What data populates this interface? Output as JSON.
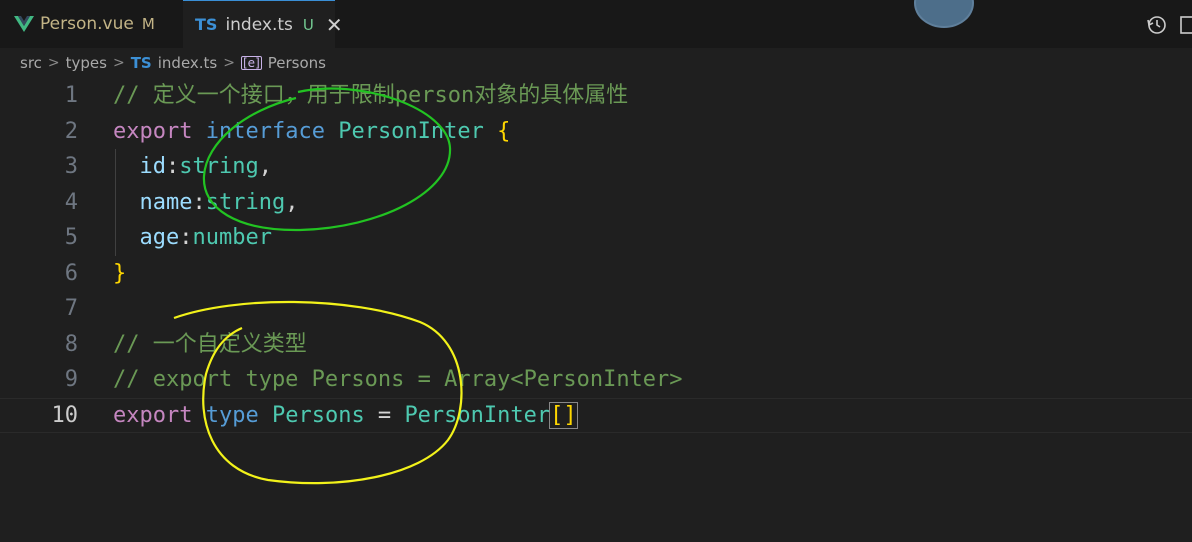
{
  "tabs": [
    {
      "label": "Person.vue",
      "status": "M",
      "icon": "vue-icon"
    },
    {
      "label": "index.ts",
      "status": "U",
      "icon": "ts-icon",
      "badge": "TS",
      "active": true
    }
  ],
  "breadcrumb": {
    "items": [
      "src",
      "types"
    ],
    "file_badge": "TS",
    "file": "index.ts",
    "symbol": "Persons"
  },
  "editor": {
    "lines": [
      {
        "n": "1",
        "tokens": [
          {
            "t": "// 定义一个接口，用于限制person对象的具体属性",
            "c": "c-cmt"
          }
        ]
      },
      {
        "n": "2",
        "tokens": [
          {
            "t": "export",
            "c": "c-kw"
          },
          {
            "t": " ",
            "c": "c-punc"
          },
          {
            "t": "interface",
            "c": "c-kw2"
          },
          {
            "t": " ",
            "c": "c-punc"
          },
          {
            "t": "PersonInter",
            "c": "c-type"
          },
          {
            "t": " ",
            "c": "c-punc"
          },
          {
            "t": "{",
            "c": "c-brace"
          }
        ]
      },
      {
        "n": "3",
        "tokens": [
          {
            "t": "  ",
            "c": "c-punc"
          },
          {
            "t": "id",
            "c": "c-prop"
          },
          {
            "t": ":",
            "c": "c-punc"
          },
          {
            "t": "string",
            "c": "c-type"
          },
          {
            "t": ",",
            "c": "c-punc"
          }
        ]
      },
      {
        "n": "4",
        "tokens": [
          {
            "t": "  ",
            "c": "c-punc"
          },
          {
            "t": "name",
            "c": "c-prop"
          },
          {
            "t": ":",
            "c": "c-punc"
          },
          {
            "t": "string",
            "c": "c-type"
          },
          {
            "t": ",",
            "c": "c-punc"
          }
        ]
      },
      {
        "n": "5",
        "tokens": [
          {
            "t": "  ",
            "c": "c-punc"
          },
          {
            "t": "age",
            "c": "c-prop"
          },
          {
            "t": ":",
            "c": "c-punc"
          },
          {
            "t": "number",
            "c": "c-type"
          }
        ]
      },
      {
        "n": "6",
        "tokens": [
          {
            "t": "}",
            "c": "c-brace"
          }
        ]
      },
      {
        "n": "7",
        "tokens": []
      },
      {
        "n": "8",
        "tokens": [
          {
            "t": "// 一个自定义类型",
            "c": "c-cmt"
          }
        ]
      },
      {
        "n": "9",
        "tokens": [
          {
            "t": "// export type Persons = Array<PersonInter>",
            "c": "c-cmt"
          }
        ]
      },
      {
        "n": "10",
        "active": true,
        "tokens": [
          {
            "t": "export",
            "c": "c-kw"
          },
          {
            "t": " ",
            "c": "c-punc"
          },
          {
            "t": "type",
            "c": "c-kw2"
          },
          {
            "t": " ",
            "c": "c-punc"
          },
          {
            "t": "Persons",
            "c": "c-type"
          },
          {
            "t": " = ",
            "c": "c-punc"
          },
          {
            "t": "PersonInter",
            "c": "c-type"
          },
          {
            "t": "[]",
            "c": "c-bracket"
          }
        ]
      }
    ]
  },
  "annotations": [
    {
      "name": "green-circle-annotation",
      "color": "#22c322"
    },
    {
      "name": "yellow-circle-annotation",
      "color": "#f2f21a"
    }
  ],
  "icons": {
    "history": "history-icon",
    "split": "split-editor-icon",
    "avatar": "avatar-icon"
  }
}
